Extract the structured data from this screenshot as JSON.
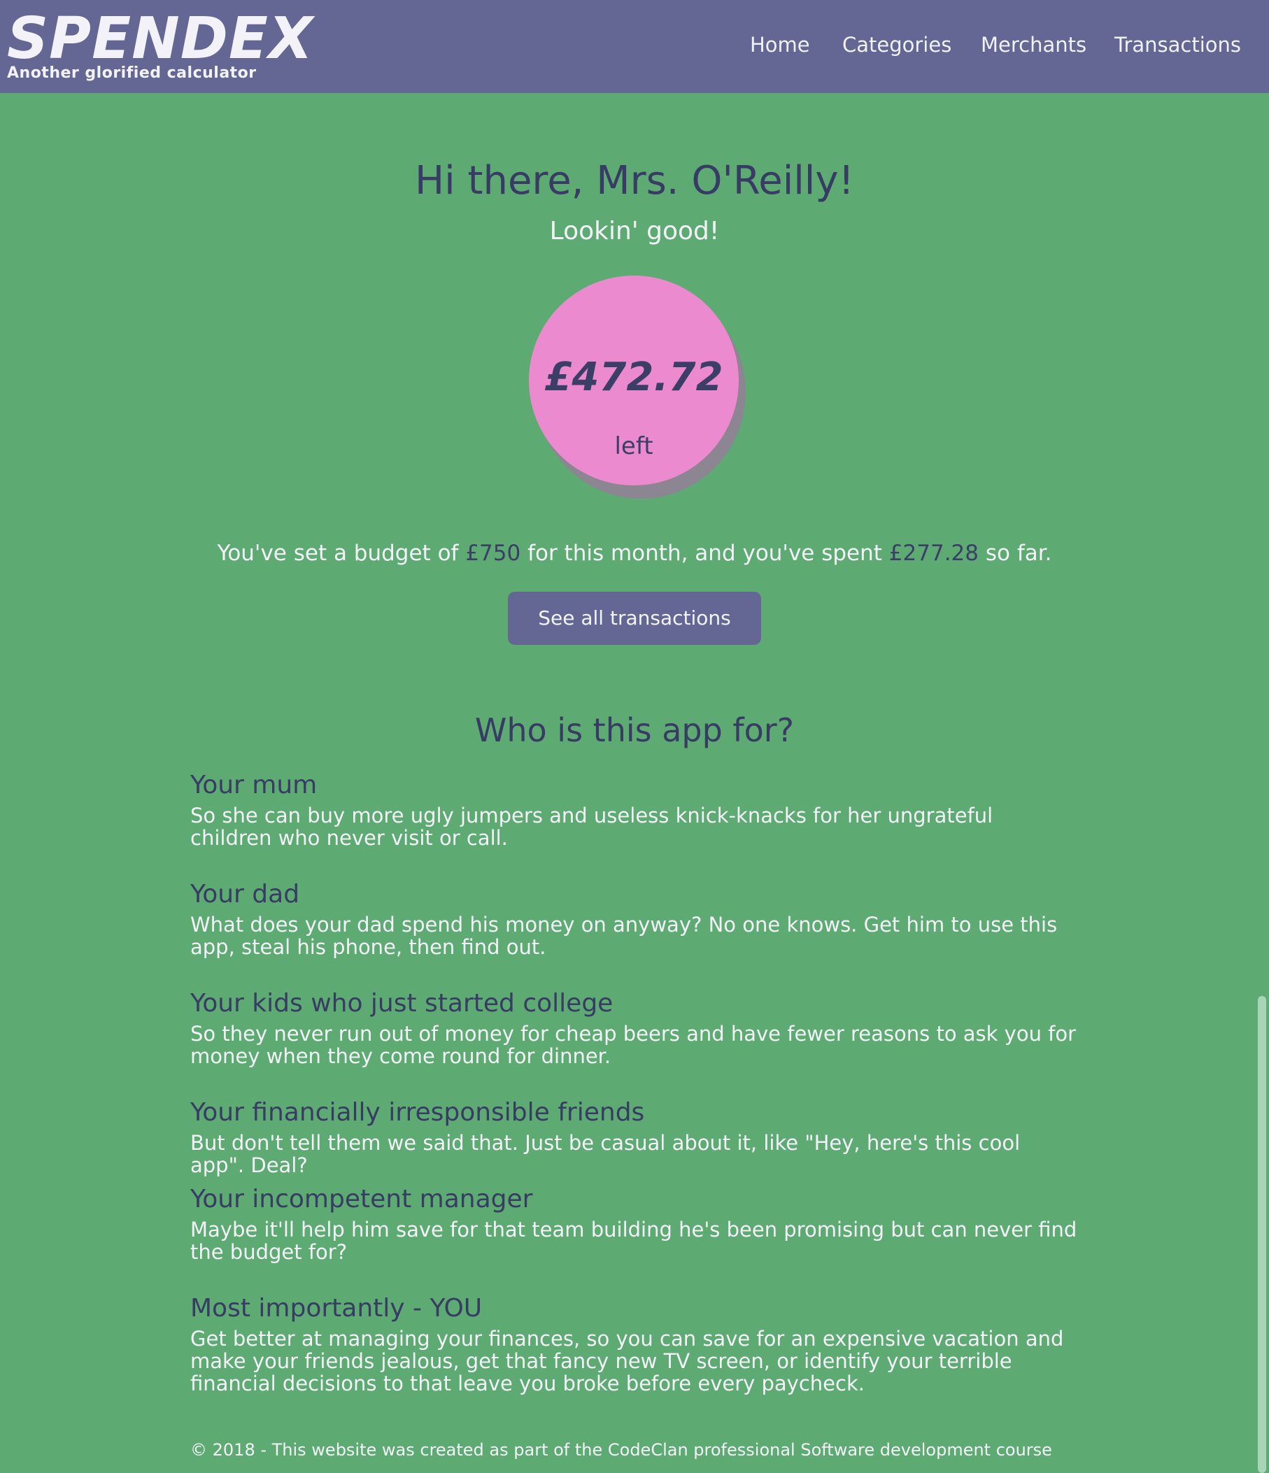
{
  "brand": {
    "name": "SPENDEX",
    "tagline": "Another glorified calculator"
  },
  "nav": {
    "items": [
      {
        "label": "Home"
      },
      {
        "label": "Categories"
      },
      {
        "label": "Merchants"
      },
      {
        "label": "Transactions"
      }
    ]
  },
  "dashboard": {
    "greeting": "Hi there, Mrs. O'Reilly!",
    "status": "Lookin' good!",
    "remaining_amount": "£472.72",
    "remaining_label": "left",
    "budget_text_1": "You've set a budget of",
    "budget_amount": "£750",
    "budget_text_2": "for this month, and you've spent",
    "spent_amount": "£277.28",
    "budget_text_3": "so far.",
    "button_label": "See all transactions"
  },
  "about": {
    "title": "Who is this app for?",
    "items": [
      {
        "heading": "Your mum",
        "text": "So she can buy more ugly jumpers and useless knick-knacks for her ungrateful children who never visit or call."
      },
      {
        "heading": "Your dad",
        "text": "What does your dad spend his money on anyway? No one knows. Get him to use this app, steal his phone, then find out."
      },
      {
        "heading": "Your kids who just started college",
        "text": "So they never run out of money for cheap beers and have fewer reasons to ask you for money when they come round for dinner."
      },
      {
        "heading": "Your financially irresponsible friends",
        "text": "But don't tell them we said that. Just be casual about it, like \"Hey, here's this cool app\". Deal?"
      },
      {
        "heading": "Your incompetent manager",
        "text": "Maybe it'll help him save for that team building he's been promising but can never find the budget for?"
      },
      {
        "heading": "Most importantly - YOU",
        "text": "Get better at managing your finances, so you can save for an expensive vacation and make your friends jealous, get that fancy new TV screen, or identify your terrible financial decisions to that leave you broke before every paycheck."
      }
    ]
  },
  "footer": {
    "text": "© 2018 - This website was created as part of the CodeClan professional Software development course"
  },
  "colors": {
    "background": "#5eaa73",
    "header": "#646794",
    "accent_text": "#383b63",
    "circle": "#ec8acf",
    "button": "#646794"
  }
}
